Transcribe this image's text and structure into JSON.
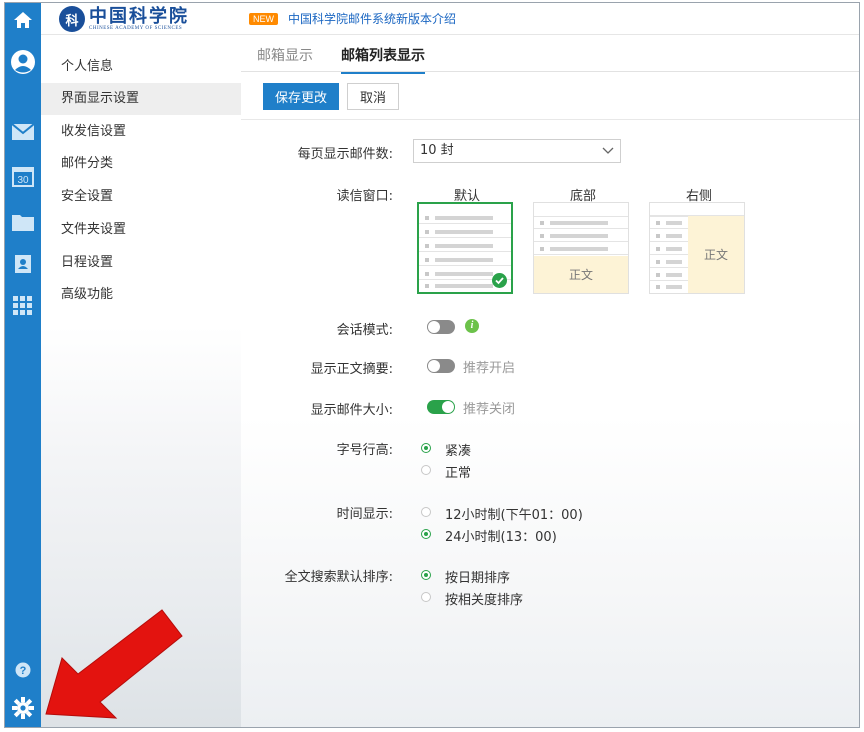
{
  "header": {
    "logo_cn": "中国科学院",
    "logo_en": "CHINESE ACADEMY OF SCIENCES",
    "logo_mark": "科",
    "news_badge": "NEW",
    "news_text": "中国科学院邮件系统新版本介绍"
  },
  "rail": {
    "icons": [
      "home-icon",
      "avatar-icon",
      "mail-icon",
      "calendar-icon",
      "folder-icon",
      "contacts-icon",
      "apps-icon",
      "help-icon",
      "gear-icon"
    ],
    "calendar_day": "30",
    "help_glyph": "?",
    "accent": "#1f7fc9"
  },
  "sidebar": {
    "items": [
      {
        "label": "个人信息"
      },
      {
        "label": "界面显示设置"
      },
      {
        "label": "收发信设置"
      },
      {
        "label": "邮件分类"
      },
      {
        "label": "安全设置"
      },
      {
        "label": "文件夹设置"
      },
      {
        "label": "日程设置"
      },
      {
        "label": "高级功能"
      }
    ],
    "active_index": 1
  },
  "tabs": [
    {
      "label": "邮箱显示"
    },
    {
      "label": "邮箱列表显示"
    }
  ],
  "toolbar": {
    "save_label": "保存更改",
    "cancel_label": "取消"
  },
  "settings": {
    "per_page": {
      "label": "每页显示邮件数:",
      "value": "10 封"
    },
    "reading_pane": {
      "label": "读信窗口:",
      "options": [
        {
          "title": "默认",
          "selected": true
        },
        {
          "title": "底部",
          "pane_text": "正文",
          "selected": false
        },
        {
          "title": "右侧",
          "pane_text": "正文",
          "selected": false
        }
      ]
    },
    "conversation": {
      "label": "会话模式:",
      "on": false,
      "info_glyph": "i"
    },
    "summary": {
      "label": "显示正文摘要:",
      "on": false,
      "hint": "推荐开启"
    },
    "size": {
      "label": "显示邮件大小:",
      "on": true,
      "hint": "推荐关闭"
    },
    "line_height": {
      "label": "字号行高:",
      "options": [
        {
          "label": "紧凑",
          "checked": true
        },
        {
          "label": "正常",
          "checked": false
        }
      ]
    },
    "time": {
      "label": "时间显示:",
      "options": [
        {
          "label": "12小时制(下午01：00)",
          "checked": false
        },
        {
          "label": "24小时制(13：00)",
          "checked": true
        }
      ]
    },
    "search_sort": {
      "label": "全文搜索默认排序:",
      "options": [
        {
          "label": "按日期排序",
          "checked": true
        },
        {
          "label": "按相关度排序",
          "checked": false
        }
      ]
    }
  },
  "colors": {
    "primary": "#1f7fc9",
    "success": "#2aa24a",
    "annotation": "#e3130f"
  }
}
